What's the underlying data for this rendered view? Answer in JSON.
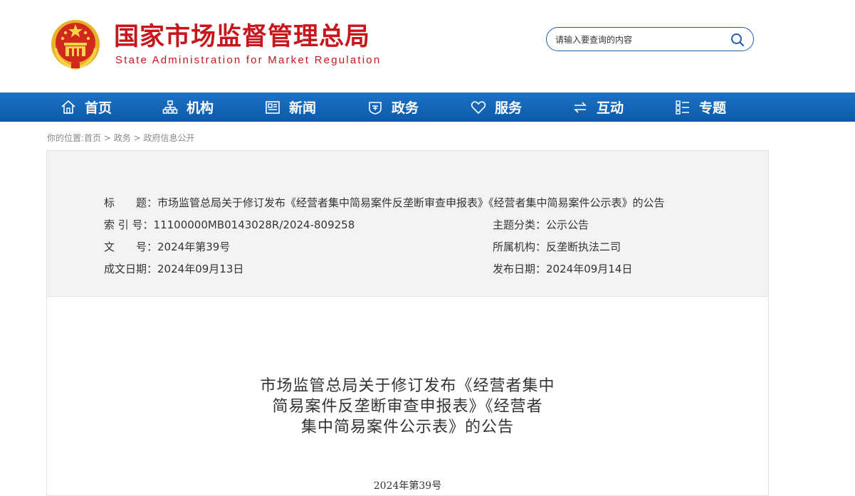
{
  "header": {
    "title_cn": "国家市场监督管理总局",
    "title_en": "State Administration for Market Regulation",
    "search": {
      "placeholder": "请输入要查询的内容"
    }
  },
  "nav": {
    "items": [
      {
        "label": "首页",
        "icon": "home-icon"
      },
      {
        "label": "机构",
        "icon": "org-chart-icon"
      },
      {
        "label": "新闻",
        "icon": "news-icon"
      },
      {
        "label": "政务",
        "icon": "shield-icon"
      },
      {
        "label": "服务",
        "icon": "heart-icon"
      },
      {
        "label": "互动",
        "icon": "exchange-arrows-icon"
      },
      {
        "label": "专题",
        "icon": "list-grid-icon"
      }
    ]
  },
  "breadcrumb": {
    "prefix": "你的位置:",
    "items": [
      "首页",
      "政务",
      "政府信息公开"
    ],
    "separator": ">"
  },
  "meta": {
    "title_label": "标　　题：",
    "title_value": "市场监管总局关于修订发布《经营者集中简易案件反垄断审查申报表》《经营者集中简易案件公示表》的公告",
    "index_label": "索 引 号：",
    "index_value": "11100000MB0143028R/2024-809258",
    "category_label": "主题分类：",
    "category_value": "公示公告",
    "docno_label": "文　　号：",
    "docno_value": "2024年第39号",
    "org_label": "所属机构：",
    "org_value": "反垄断执法二司",
    "written_label": "成文日期：",
    "written_value": "2024年09月13日",
    "publish_label": "发布日期：",
    "publish_value": "2024年09月14日"
  },
  "article": {
    "title_lines": [
      "市场监管总局关于修订发布《经营者集中",
      "简易案件反垄断审查申报表》《经营者",
      "集中简易案件公示表》的公告"
    ],
    "doc_number": "2024年第39号"
  },
  "colors": {
    "brand_red": "#c8161d",
    "nav_blue": "#0d59a9",
    "meta_bg": "#f3f3f3"
  }
}
